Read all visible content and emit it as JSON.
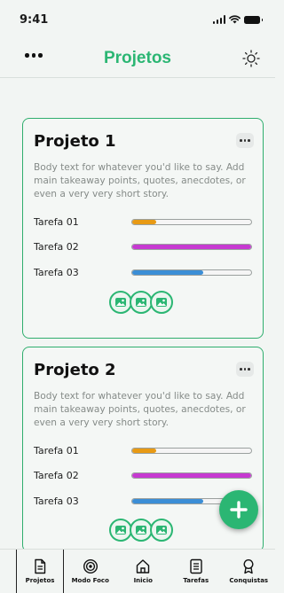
{
  "status_bar": {
    "time": "9:41"
  },
  "header": {
    "title": "Projetos",
    "menu_icon": "more-horizontal-icon",
    "theme_icon": "sun-icon"
  },
  "colors": {
    "accent": "#2bb673",
    "orange": "#e89a14",
    "magenta": "#c63ad1",
    "blue": "#3b8ed6"
  },
  "projects": [
    {
      "title": "Projeto 1",
      "body": "Body text for whatever you'd like to say. Add main takeaway points, quotes, anecdotes, or even a very very short story.",
      "tasks": [
        {
          "label": "Tarefa 01",
          "progress": 0.2,
          "color": "#e89a14"
        },
        {
          "label": "Tarefa 02",
          "progress": 1.0,
          "color": "#c63ad1"
        },
        {
          "label": "Tarefa 03",
          "progress": 0.6,
          "color": "#3b8ed6"
        }
      ],
      "member_icons": [
        "image-icon",
        "image-icon",
        "image-icon"
      ]
    },
    {
      "title": "Projeto 2",
      "body": "Body text for whatever you'd like to say. Add main takeaway points, quotes, anecdotes, or even a very very short story.",
      "tasks": [
        {
          "label": "Tarefa 01",
          "progress": 0.2,
          "color": "#e89a14"
        },
        {
          "label": "Tarefa 02",
          "progress": 1.0,
          "color": "#c63ad1"
        },
        {
          "label": "Tarefa 03",
          "progress": 0.6,
          "color": "#3b8ed6"
        }
      ],
      "member_icons": [
        "image-icon",
        "image-icon",
        "image-icon"
      ]
    }
  ],
  "fab": {
    "icon": "plus-icon"
  },
  "nav": [
    {
      "label": "Projetos",
      "icon": "document-icon",
      "active": true
    },
    {
      "label": "Modo Foco",
      "icon": "target-icon",
      "active": false
    },
    {
      "label": "Inicio",
      "icon": "home-icon",
      "active": false
    },
    {
      "label": "Tarefas",
      "icon": "list-icon",
      "active": false
    },
    {
      "label": "Conquistas",
      "icon": "award-icon",
      "active": false
    }
  ]
}
